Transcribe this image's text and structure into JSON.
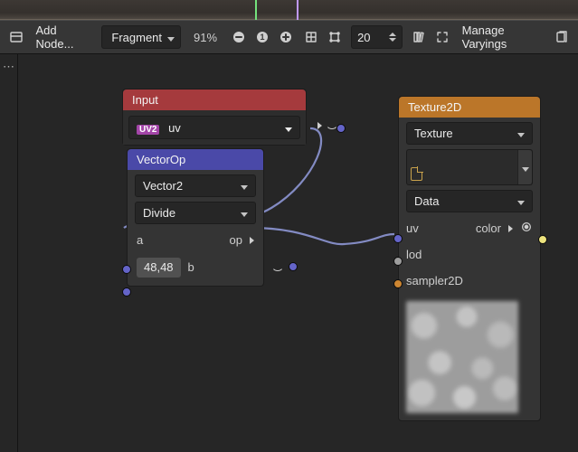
{
  "viewport": {},
  "toolbar": {
    "add_node_label": "Add Node...",
    "shader_stage": "Fragment",
    "zoom_percent": "91%",
    "grid_value": "20",
    "manage_varyings_label": "Manage Varyings"
  },
  "nodes": {
    "input": {
      "title": "Input",
      "param_badge": "UV2",
      "param_name": "uv"
    },
    "vector_op": {
      "title": "VectorOp",
      "type_value": "Vector2",
      "op_value": "Divide",
      "port_a_label": "a",
      "port_op_label": "op",
      "port_b_value": "48,48",
      "port_b_label": "b"
    },
    "texture2d": {
      "title": "Texture2D",
      "texture_label": "Texture",
      "data_label": "Data",
      "port_uv_label": "uv",
      "port_color_label": "color",
      "port_lod_label": "lod",
      "port_sampler_label": "sampler2D"
    }
  },
  "colors": {
    "port_vector": "#6464c8",
    "port_scalar": "#9d9d9d",
    "port_sampler": "#cd8632",
    "port_color_output": "#ece27d",
    "wire": "#838bc3"
  }
}
